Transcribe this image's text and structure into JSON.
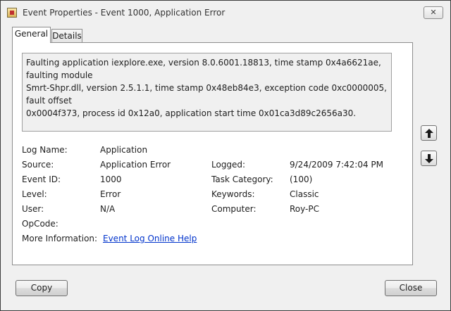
{
  "window": {
    "title": "Event Properties - Event 1000, Application Error",
    "app_icon": "event-log-icon",
    "close_glyph": "✕"
  },
  "tabs": [
    {
      "label": "General",
      "selected": true
    },
    {
      "label": "Details",
      "selected": false
    }
  ],
  "description": "Faulting application iexplore.exe, version 8.0.6001.18813, time stamp 0x4a6621ae, faulting module\nSmrt-Shpr.dll, version 2.5.1.1, time stamp 0x48eb84e3, exception code 0xc0000005, fault offset\n0x0004f373, process id 0x12a0, application start time 0x01ca3d89c2656a30.",
  "fields": {
    "log_name": {
      "label": "Log Name:",
      "value": "Application"
    },
    "source": {
      "label": "Source:",
      "value": "Application Error"
    },
    "logged": {
      "label": "Logged:",
      "value": "9/24/2009 7:42:04 PM"
    },
    "event_id": {
      "label": "Event ID:",
      "value": "1000"
    },
    "task_category": {
      "label": "Task Category:",
      "value": "(100)"
    },
    "level": {
      "label": "Level:",
      "value": "Error"
    },
    "keywords": {
      "label": "Keywords:",
      "value": "Classic"
    },
    "user": {
      "label": "User:",
      "value": "N/A"
    },
    "computer": {
      "label": "Computer:",
      "value": "Roy-PC"
    },
    "opcode": {
      "label": "OpCode:",
      "value": ""
    },
    "more_info": {
      "label": "More Information:",
      "link_text": "Event Log Online Help"
    }
  },
  "nav": {
    "up_icon": "arrow-up-icon",
    "down_icon": "arrow-down-icon"
  },
  "buttons": {
    "copy": "Copy",
    "close": "Close"
  }
}
